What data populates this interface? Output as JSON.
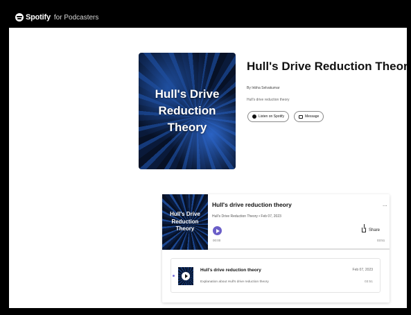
{
  "brand": {
    "name": "Spotify",
    "suffix": "for Podcasters",
    "logo_icon": "spotify-logo-icon"
  },
  "show": {
    "cover_title": "Hull's Drive Reduction Theory",
    "title": "Hull's Drive Reduction Theory",
    "author": "By Inbha Selvakumar",
    "description": "Hull's drive reduction theory",
    "listen_label": "Listen on Spotify",
    "message_label": "Message"
  },
  "player": {
    "thumb_title": "Hull's Drive Reduction Theory",
    "episode_title": "Hull's drive reduction theory",
    "meta": "Hull's Drive Reduction Theory • Feb 07, 2023",
    "more_label": "...",
    "share_label": "Share",
    "time_current": "00:00",
    "time_total": "03:51",
    "progress_percent": 0,
    "accent_color": "#6b5fc8"
  },
  "episodes": [
    {
      "title": "Hull's drive reduction theory",
      "description": "Explanation about Hull's drive reduction theory",
      "date": "Feb 07, 2023",
      "duration": "03:51"
    }
  ]
}
